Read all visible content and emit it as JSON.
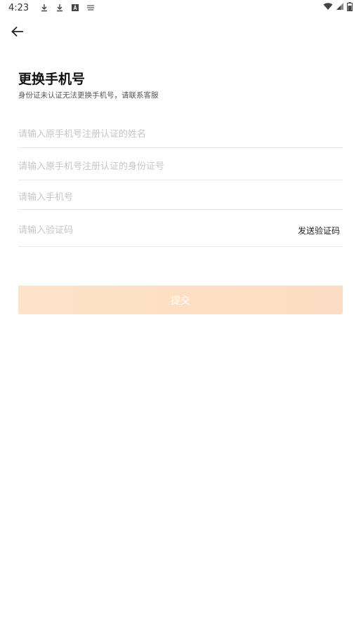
{
  "status_bar": {
    "time": "4:23",
    "left_icons": [
      "download-icon",
      "download-icon",
      "a-box-icon",
      "notification-icon"
    ],
    "right_icons": [
      "wifi-icon",
      "signal-icon",
      "battery-icon"
    ]
  },
  "nav": {
    "back_icon": "arrow-left-icon"
  },
  "page": {
    "title": "更换手机号",
    "subtitle": "身份证未认证无法更换手机号，请联系客服"
  },
  "form": {
    "name_placeholder": "请输入原手机号注册认证的姓名",
    "id_placeholder": "请输入原手机号注册认证的身份证号",
    "phone_placeholder": "请输入手机号",
    "code_placeholder": "请输入验证码",
    "send_code_label": "发送验证码",
    "submit_label": "提交"
  },
  "colors": {
    "submit_bg": "#fde0c4",
    "submit_text": "#ffffff",
    "placeholder": "#c6c6c6",
    "divider": "#e8e8e8"
  }
}
